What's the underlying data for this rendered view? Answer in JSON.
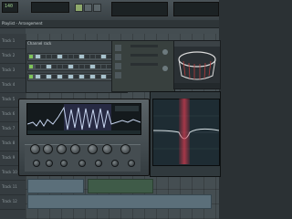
{
  "toolbar": {
    "tempo": "140",
    "pattern_display": "",
    "buttons": [
      "play",
      "stop",
      "record"
    ]
  },
  "playlist": {
    "title": "Playlist - Arrangement",
    "tracks": [
      "Track 1",
      "Track 2",
      "Track 3",
      "Track 4",
      "Track 5",
      "Track 6",
      "Track 7",
      "Track 8",
      "Track 9",
      "Track 10",
      "Track 11",
      "Track 12"
    ]
  },
  "channel_rack": {
    "title": "Channel rack",
    "rows": [
      {
        "steps": [
          1,
          0,
          0,
          0,
          1,
          0,
          0,
          0,
          1,
          0,
          0,
          0,
          1,
          0,
          0,
          0
        ]
      },
      {
        "steps": [
          0,
          0,
          1,
          0,
          0,
          0,
          1,
          0,
          0,
          0,
          1,
          0,
          0,
          0,
          1,
          0
        ]
      },
      {
        "steps": [
          1,
          0,
          1,
          0,
          1,
          0,
          1,
          0,
          1,
          0,
          1,
          0,
          1,
          0,
          1,
          0
        ]
      }
    ]
  },
  "drum_plugin": {
    "title": ""
  },
  "synth_plugin": {
    "title": ""
  },
  "eq_plugin": {
    "title": "",
    "label": ""
  },
  "colors": {
    "accent": "#9fd08e",
    "eq_band": "#d03c50",
    "wave": "#b8c8e8"
  }
}
